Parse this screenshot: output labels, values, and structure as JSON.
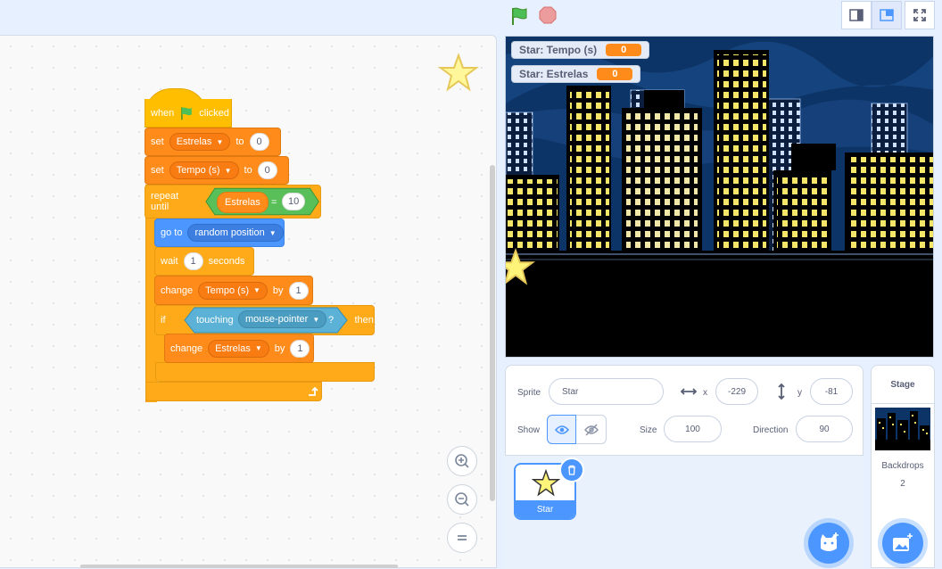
{
  "toolbar": {
    "green_flag_icon": "green-flag-icon",
    "stop_icon": "stop-sign-icon",
    "modes": [
      "small-stage-mode",
      "normal-stage-mode",
      "fullscreen-mode"
    ]
  },
  "script": {
    "when_label": "when",
    "clicked_label": "clicked",
    "set1": {
      "label": "set",
      "var": "Estrelas",
      "to": "to",
      "value": "0"
    },
    "set2": {
      "label": "set",
      "var": "Tempo (s)",
      "to": "to",
      "value": "0"
    },
    "repeat": {
      "label": "repeat until",
      "var": "Estrelas",
      "op": "=",
      "value": "10"
    },
    "goto": {
      "label": "go to",
      "target": "random position"
    },
    "wait": {
      "label": "wait",
      "value": "1",
      "unit": "seconds"
    },
    "change1": {
      "label": "change",
      "var": "Tempo (s)",
      "by": "by",
      "value": "1"
    },
    "if": {
      "label": "if",
      "touching": "touching",
      "target": "mouse-pointer",
      "q": "?",
      "then": "then"
    },
    "change2": {
      "label": "change",
      "var": "Estrelas",
      "by": "by",
      "value": "1"
    }
  },
  "stage": {
    "monitors": [
      {
        "label": "Star: Tempo (s)",
        "value": "0"
      },
      {
        "label": "Star: Estrelas",
        "value": "0"
      }
    ]
  },
  "sprite_info": {
    "sprite_label": "Sprite",
    "sprite_name": "Star",
    "x_label": "x",
    "x_value": "-229",
    "y_label": "y",
    "y_value": "-81",
    "show_label": "Show",
    "size_label": "Size",
    "size_value": "100",
    "direction_label": "Direction",
    "direction_value": "90"
  },
  "sprites": [
    {
      "name": "Star"
    }
  ],
  "stage_panel": {
    "title": "Stage",
    "backdrops_label": "Backdrops",
    "backdrops_count": "2"
  },
  "colors": {
    "events": "#ffbf00",
    "variables": "#ff8c1a",
    "control": "#ffab19",
    "motion": "#4c97ff",
    "sensing": "#5cb1d6",
    "operators": "#59c059"
  }
}
